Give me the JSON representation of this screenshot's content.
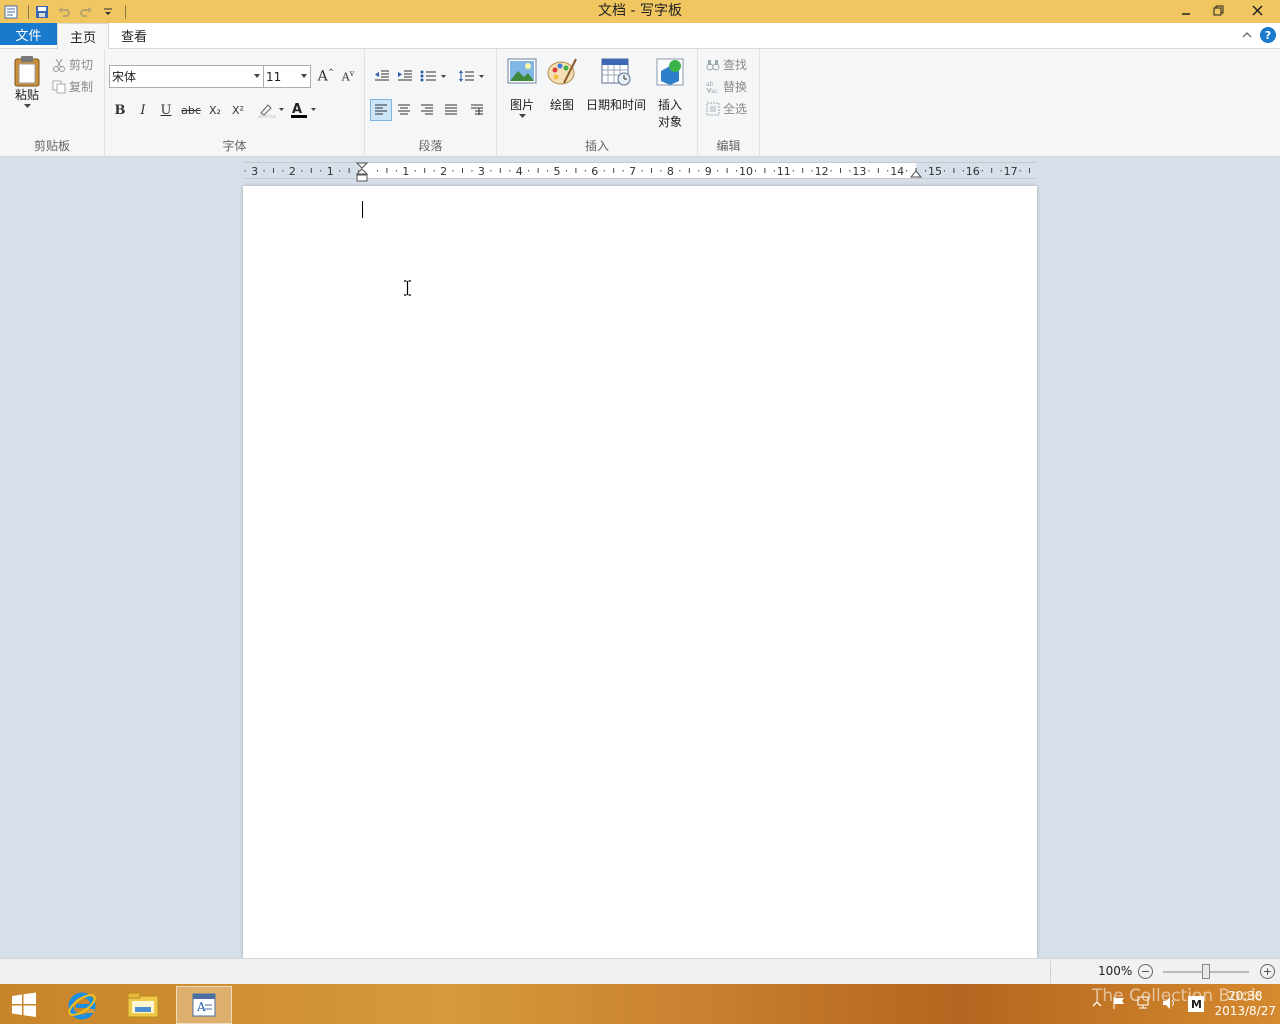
{
  "window": {
    "title": "文档 - 写字板"
  },
  "ribbon_tabs": {
    "file": "文件",
    "home": "主页",
    "view": "查看"
  },
  "clipboard": {
    "paste": "粘贴",
    "cut": "剪切",
    "copy": "复制",
    "label": "剪贴板"
  },
  "font": {
    "family": "宋体",
    "size": "11",
    "label": "字体",
    "bold": "B",
    "italic": "I",
    "underline": "U",
    "strike": "abc",
    "subscript": "X₂",
    "superscript": "X²"
  },
  "paragraph": {
    "label": "段落"
  },
  "insert": {
    "picture": "图片",
    "paint": "绘图",
    "datetime": "日期和时间",
    "object_line1": "插入",
    "object_line2": "对象",
    "label": "插入"
  },
  "editing": {
    "find": "查找",
    "replace": "替换",
    "select_all": "全选",
    "label": "编辑"
  },
  "ruler": {
    "labels": [
      "3",
      "2",
      "1",
      "1",
      "2",
      "3",
      "4",
      "5",
      "6",
      "7",
      "8",
      "9",
      "10",
      "11",
      "12",
      "13",
      "14",
      "15",
      "16",
      "17"
    ]
  },
  "status": {
    "zoom": "100%",
    "zoom_level": 0.5
  },
  "taskbar": {
    "time": "20:38",
    "date": "2013/8/27",
    "watermark": "The Collection Book"
  },
  "colors": {
    "titlebar": "#f0c660",
    "file_tab": "#1979ca",
    "taskbar": "#c8842a"
  }
}
